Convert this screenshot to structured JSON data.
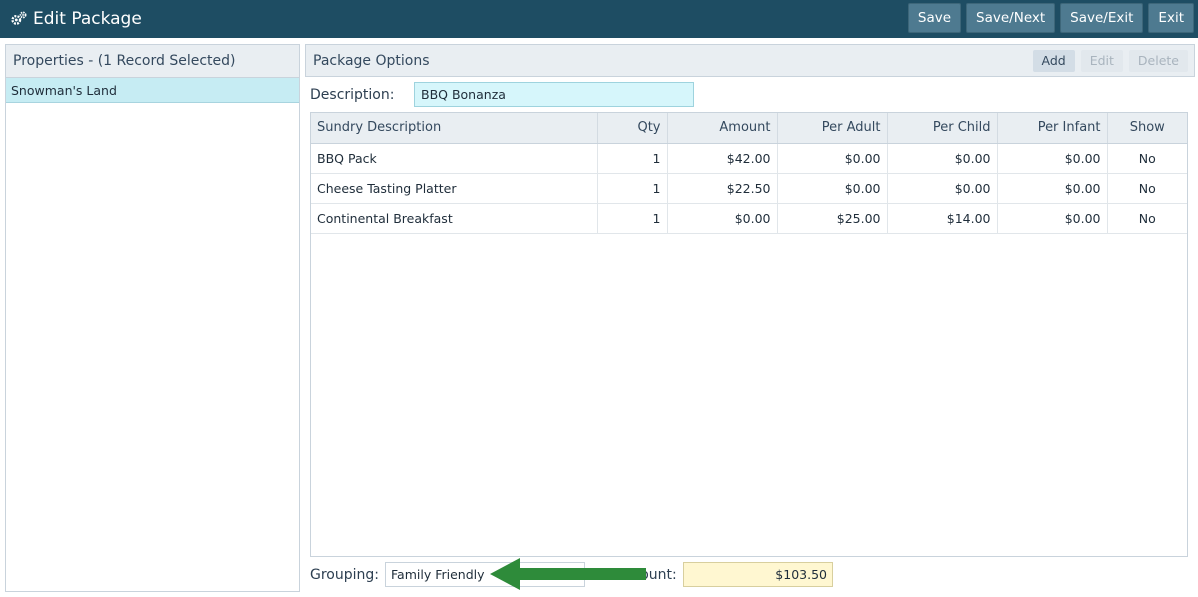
{
  "window": {
    "title": "Edit Package",
    "icon": "gears-icon"
  },
  "toolbar": {
    "save_label": "Save",
    "save_next_label": "Save/Next",
    "save_exit_label": "Save/Exit",
    "exit_label": "Exit"
  },
  "properties": {
    "header": "Properties - (1 Record Selected)",
    "items": [
      {
        "label": "Snowman's Land"
      }
    ]
  },
  "package_options": {
    "title": "Package Options",
    "add_label": "Add",
    "edit_label": "Edit",
    "delete_label": "Delete"
  },
  "description": {
    "label": "Description:",
    "value": "BBQ Bonanza"
  },
  "grid": {
    "columns": [
      "Sundry Description",
      "Qty",
      "Amount",
      "Per Adult",
      "Per Child",
      "Per Infant",
      "Show"
    ],
    "rows": [
      {
        "desc": "BBQ Pack",
        "qty": "1",
        "amount": "$42.00",
        "per_adult": "$0.00",
        "per_child": "$0.00",
        "per_infant": "$0.00",
        "show": "No"
      },
      {
        "desc": "Cheese Tasting Platter",
        "qty": "1",
        "amount": "$22.50",
        "per_adult": "$0.00",
        "per_child": "$0.00",
        "per_infant": "$0.00",
        "show": "No"
      },
      {
        "desc": "Continental Breakfast",
        "qty": "1",
        "amount": "$0.00",
        "per_adult": "$25.00",
        "per_child": "$14.00",
        "per_infant": "$0.00",
        "show": "No"
      }
    ]
  },
  "grouping": {
    "label": "Grouping:",
    "value": "Family Friendly"
  },
  "amount": {
    "label": "Amount:",
    "value": "$103.50"
  },
  "annotation": {
    "arrow_color": "#2e8b3a"
  }
}
